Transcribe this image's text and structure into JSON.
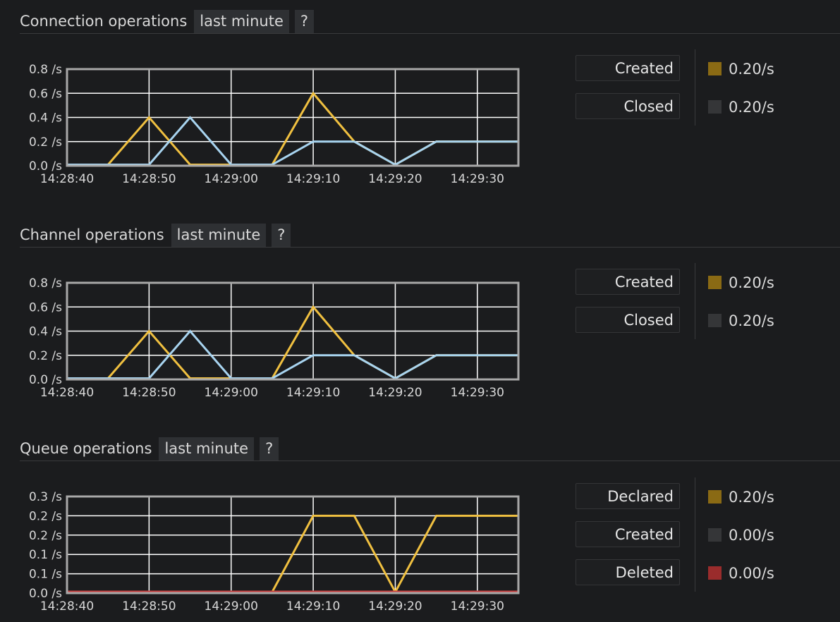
{
  "colors": {
    "series_yellow": "#f0c040",
    "series_blue": "#a8d4f0",
    "series_red": "#c84040",
    "swatch_yellow": "#8a6a14",
    "swatch_gray": "#353638",
    "swatch_red": "#9a2c2c",
    "grid": "#ffffff",
    "frame": "#a8a8a8"
  },
  "sections": [
    {
      "title": "Connection operations",
      "range_label": "last minute",
      "help_label": "?",
      "legend": [
        {
          "label": "Created",
          "rate": "0.20/s",
          "swatch": "swatch_yellow"
        },
        {
          "label": "Closed",
          "rate": "0.20/s",
          "swatch": "swatch_gray"
        }
      ]
    },
    {
      "title": "Channel operations",
      "range_label": "last minute",
      "help_label": "?",
      "legend": [
        {
          "label": "Created",
          "rate": "0.20/s",
          "swatch": "swatch_yellow"
        },
        {
          "label": "Closed",
          "rate": "0.20/s",
          "swatch": "swatch_gray"
        }
      ]
    },
    {
      "title": "Queue operations",
      "range_label": "last minute",
      "help_label": "?",
      "legend": [
        {
          "label": "Declared",
          "rate": "0.20/s",
          "swatch": "swatch_yellow"
        },
        {
          "label": "Created",
          "rate": "0.00/s",
          "swatch": "swatch_gray"
        },
        {
          "label": "Deleted",
          "rate": "0.00/s",
          "swatch": "swatch_red"
        }
      ]
    }
  ],
  "chart_data": [
    {
      "type": "line",
      "x_tick_labels": [
        "14:28:40",
        "14:28:50",
        "14:29:00",
        "14:29:10",
        "14:29:20",
        "14:29:30"
      ],
      "x": [
        0,
        5,
        10,
        15,
        20,
        25,
        30,
        35,
        40,
        45,
        50,
        55
      ],
      "y_tick_labels": [
        "0.0 /s",
        "0.2 /s",
        "0.4 /s",
        "0.6 /s",
        "0.8 /s"
      ],
      "ylim": [
        0,
        0.8
      ],
      "grid": true,
      "series": [
        {
          "color": "series_yellow",
          "values": [
            0,
            0,
            0.4,
            0,
            0,
            0,
            0.6,
            0.2,
            0,
            0.2,
            0.2,
            0.2
          ]
        },
        {
          "color": "series_blue",
          "values": [
            0,
            0,
            0,
            0.4,
            0,
            0,
            0.2,
            0.2,
            0,
            0.2,
            0.2,
            0.2
          ]
        }
      ]
    },
    {
      "type": "line",
      "x_tick_labels": [
        "14:28:40",
        "14:28:50",
        "14:29:00",
        "14:29:10",
        "14:29:20",
        "14:29:30"
      ],
      "x": [
        0,
        5,
        10,
        15,
        20,
        25,
        30,
        35,
        40,
        45,
        50,
        55
      ],
      "y_tick_labels": [
        "0.0 /s",
        "0.2 /s",
        "0.4 /s",
        "0.6 /s",
        "0.8 /s"
      ],
      "ylim": [
        0,
        0.8
      ],
      "grid": true,
      "series": [
        {
          "color": "series_yellow",
          "values": [
            0,
            0,
            0.4,
            0,
            0,
            0,
            0.6,
            0.2,
            0,
            0.2,
            0.2,
            0.2
          ]
        },
        {
          "color": "series_blue",
          "values": [
            0,
            0,
            0,
            0.4,
            0,
            0,
            0.2,
            0.2,
            0,
            0.2,
            0.2,
            0.2
          ]
        }
      ]
    },
    {
      "type": "line",
      "x_tick_labels": [
        "14:28:40",
        "14:28:50",
        "14:29:00",
        "14:29:10",
        "14:29:20",
        "14:29:30"
      ],
      "x": [
        0,
        5,
        10,
        15,
        20,
        25,
        30,
        35,
        40,
        45,
        50,
        55
      ],
      "y_tick_labels": [
        "0.0 /s",
        "0.1 /s",
        "0.1 /s",
        "0.2 /s",
        "0.2 /s",
        "0.3 /s"
      ],
      "ylim": [
        0,
        0.25
      ],
      "grid": true,
      "series": [
        {
          "color": "series_yellow",
          "values": [
            0,
            0,
            0,
            0,
            0,
            0,
            0.2,
            0.2,
            0,
            0.2,
            0.2,
            0.2
          ]
        },
        {
          "color": "series_red",
          "values": [
            0,
            0,
            0,
            0,
            0,
            0,
            0,
            0,
            0,
            0,
            0,
            0
          ]
        }
      ]
    }
  ]
}
